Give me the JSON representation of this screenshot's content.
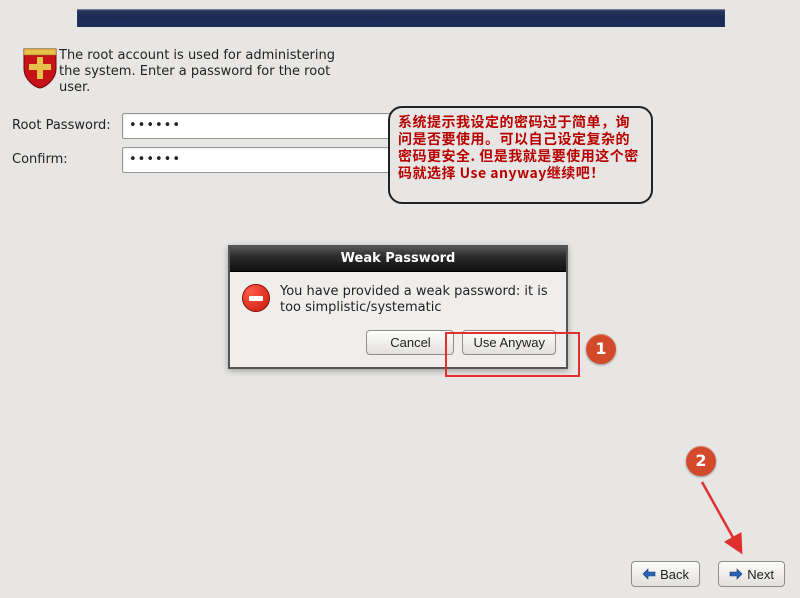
{
  "intro": "The root account is used for administering the system.  Enter a password for the root user.",
  "labels": {
    "root_password": "Root Password:",
    "confirm": "Confirm:"
  },
  "fields": {
    "root_password_value": "••••••",
    "confirm_value": "••••••"
  },
  "callout": "系统提示我设定的密码过于简单，询问是否要使用。可以自己设定复杂的密码更安全. 但是我就是要使用这个密码就选择 Use anyway继续吧！",
  "dialog": {
    "title": "Weak Password",
    "message": "You have provided a weak password: it is too simplistic/systematic",
    "cancel": "Cancel",
    "use_anyway": "Use Anyway"
  },
  "steps": {
    "one": "1",
    "two": "2"
  },
  "footer": {
    "back": "Back",
    "next": "Next"
  },
  "icons": {
    "shield": "shield-icon",
    "error": "error-icon",
    "back_arrow": "arrow-left-icon",
    "next_arrow": "arrow-right-icon"
  }
}
